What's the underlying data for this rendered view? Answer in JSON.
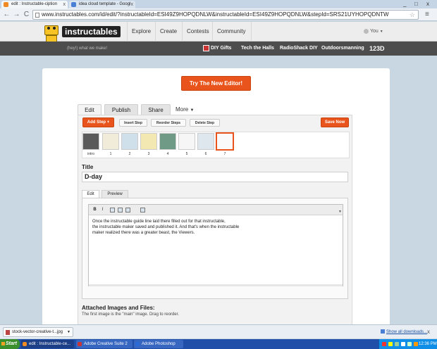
{
  "browser": {
    "tabs": [
      {
        "title": "edit : Instructable-ciption",
        "close": "x"
      },
      {
        "title": "idea cloud template - Googl",
        "close": "x"
      }
    ],
    "window_controls": [
      "_",
      "□",
      "x"
    ],
    "address": "www.instructables.com/id/edit/?instructableId=ESI49Z9HOPQDNLW&instructableId=ESI49Z9HOPQDNLW&stepId=SRS21UYHOPQDNTW",
    "nav": {
      "back": "←",
      "forward": "→",
      "reload": "C"
    }
  },
  "site": {
    "logo": "instructables",
    "nav": [
      "Explore",
      "Create",
      "Contests",
      "Community"
    ],
    "user": "You",
    "tagline": "(hey!) what we make!",
    "sublinks": [
      "DIY Gifts",
      "Tech the Halls",
      "RadioShack DIY",
      "Outdoorsmanning",
      "123D"
    ]
  },
  "editor": {
    "try_button": "Try The New Editor!",
    "tabs": [
      "Edit",
      "Publish",
      "Share"
    ],
    "more": "More",
    "add_step": "Add Step +",
    "step_buttons": [
      "Insert Step",
      "Reorder Steps",
      "Delete Step"
    ],
    "save": "Save Now",
    "steps": [
      "intro",
      "1",
      "2",
      "3",
      "4",
      "5",
      "6",
      "7"
    ],
    "selected_step": 7,
    "title_label": "Title",
    "title_value": "D-day",
    "edit_tabs": [
      "Edit",
      "Preview"
    ],
    "toolbar_buttons": [
      "B",
      "I"
    ],
    "body_lines": [
      "Once the instructable guide line laid there filled out for that instructable,",
      "the instructable maker saved and published it. And that's when the instructable",
      "maker realized there was a greater beast, the Viewers."
    ],
    "attach_label": "Attached Images and Files:",
    "attach_sub": "The first image is the \"main\" image. Drag to reorder."
  },
  "downloads": {
    "file": "stock-vector-creative-t...jpg",
    "show_all": "Show all downloads...",
    "close": "x"
  },
  "taskbar": {
    "start": "Start",
    "items": [
      "edit : Instructable-ce...",
      "Adobe Creative Suite 2",
      "Adobe Photoshop"
    ],
    "clock": "12:36 PM"
  },
  "colors": {
    "accent": "#e8541b",
    "subbar": "#4d4d4d",
    "taskbar": "#1f4fa8"
  }
}
